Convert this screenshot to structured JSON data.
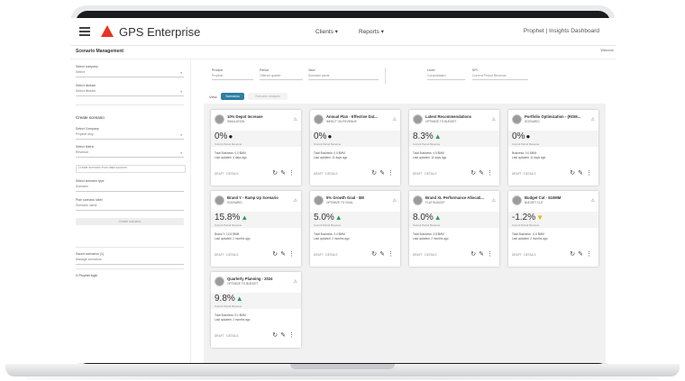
{
  "app": {
    "brand": "GPS Enterprise"
  },
  "nav": {
    "clients": "Clients ▾",
    "reports": "Reports ▾"
  },
  "topright": "Prophet | Insights Dashboard",
  "page": {
    "title": "Scenario Management",
    "edge": "Welcome"
  },
  "sidebar": {
    "select_company_label": "Select company",
    "select_company_value": "Select",
    "select_division_label": "Select division",
    "select_division_value": "Select division",
    "create_heading": "Create scenario",
    "field_a_label": "Select Company",
    "field_a_value": "Prophet only",
    "field_b_label": "Select Metric",
    "field_b_value": "Revenue",
    "field_c_placeholder": "Create scenario from data sources",
    "field_d_label": "Select scenario type",
    "field_d_value": "Scenario",
    "field_e_label": "Plan scenario label",
    "field_e_value": "Scenario name",
    "create_button": "Create scenario",
    "saved_label": "Saved scenarios (1)",
    "saved_value": "Manage scenarios",
    "footer_link": "Prophet login"
  },
  "filters": {
    "product_label": "Product",
    "product_value": "Prophet",
    "period_label": "Period",
    "period_value": "Offered quarter",
    "view_label": "View",
    "view_value": "Scenario cards",
    "level_label": "Level",
    "level_value": "Consolidated",
    "kpi_label": "KPI",
    "kpi_value": "Current Period Revenue"
  },
  "chips": {
    "label": "View",
    "active": "Scenarios",
    "inactive": "Scenario analysis"
  },
  "colors": {
    "accent": "#2f7ea3",
    "brand": "#e63323",
    "up": "#2e9e5a",
    "down": "#f0b400"
  },
  "cards": [
    {
      "title": "10% Depot Increase",
      "subtitle": "SIMULATION",
      "value": "0%",
      "trend": "neutral",
      "kpi_label": "Current Period Revenue",
      "meta1": "Total Business: 0.0 $MM",
      "meta2": "Last updated: 4 days ago",
      "foot": "DRAFT · DETAILS"
    },
    {
      "title": "Annual Plan - Effective Dat...",
      "subtitle": "IMPACT ON REVENUE",
      "value": "0%",
      "trend": "neutral",
      "kpi_label": "Current Period Revenue",
      "meta1": "Total Business: 0.0 $MM",
      "meta2": "Last updated: 11 days ago",
      "foot": "DRAFT · DETAILS"
    },
    {
      "title": "Latest Recommendations",
      "subtitle": "OPTIMIZE TO BUDGET",
      "value": "8.3%",
      "trend": "up",
      "kpi_label": "Current Period Revenue",
      "meta1": "Total Business: 4.5 $MM",
      "meta2": "Last updated: 11 days ago",
      "foot": "DRAFT · DETAILS"
    },
    {
      "title": "Portfolio Optimization - (ROM...",
      "subtitle": "SCENARIO",
      "value": "0%",
      "trend": "neutral",
      "kpi_label": "Current Period Revenue",
      "meta1": "Business: 0.0 $MM",
      "meta2": "Last updated: 11 days ago",
      "foot": "DRAFT · DETAILS"
    },
    {
      "title": "Brand Y - Ramp Up Scenario",
      "subtitle": "SCENARIO",
      "value": "15.8%",
      "trend": "up",
      "kpi_label": "Current Period Revenue",
      "meta1": "Brand Y: 12.5 $MM",
      "meta2": "Last updated: 2 months ago",
      "foot": "DRAFT · DETAILS"
    },
    {
      "title": "5% Growth Goal - $M",
      "subtitle": "OPTIMIZE TO GOAL",
      "value": "5.0%",
      "trend": "up",
      "kpi_label": "Current Period Revenue",
      "meta1": "Total Business: 2.4 $MM",
      "meta2": "Last updated: 2 months ago",
      "foot": "DRAFT · DETAILS"
    },
    {
      "title": "Brand XL Performance Allocati...",
      "subtitle": "FLAT BUDGET",
      "value": "8.0%",
      "trend": "up",
      "kpi_label": "Current Period Revenue",
      "meta1": "Total Business: 3.8 $MM",
      "meta2": "Last updated: 2 months ago",
      "foot": "DRAFT · DETAILS"
    },
    {
      "title": "Budget Cut - $10MM",
      "subtitle": "BUDGET CUT",
      "value": "-1.2%",
      "trend": "down",
      "kpi_label": "Current Period Revenue",
      "meta1": "Total Business: -0.6 $MM",
      "meta2": "Last updated: 2 months ago",
      "foot": "DRAFT · DETAILS"
    },
    {
      "title": "Quarterly Planning - 2024",
      "subtitle": "OPTIMIZE TO BUDGET",
      "value": "9.8%",
      "trend": "up",
      "kpi_label": "Current Period Revenue",
      "meta1": "Total Business: 5.1 $MM",
      "meta2": "Last updated: 2 months ago",
      "foot": "DRAFT · DETAILS"
    }
  ]
}
